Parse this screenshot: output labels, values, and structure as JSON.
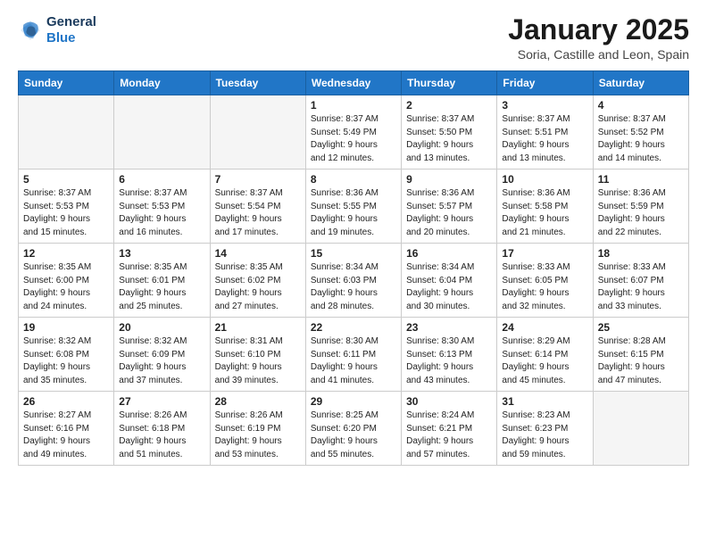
{
  "header": {
    "logo_line1": "General",
    "logo_line2": "Blue",
    "month": "January 2025",
    "location": "Soria, Castille and Leon, Spain"
  },
  "weekdays": [
    "Sunday",
    "Monday",
    "Tuesday",
    "Wednesday",
    "Thursday",
    "Friday",
    "Saturday"
  ],
  "weeks": [
    [
      {
        "day": "",
        "info": ""
      },
      {
        "day": "",
        "info": ""
      },
      {
        "day": "",
        "info": ""
      },
      {
        "day": "1",
        "info": "Sunrise: 8:37 AM\nSunset: 5:49 PM\nDaylight: 9 hours\nand 12 minutes."
      },
      {
        "day": "2",
        "info": "Sunrise: 8:37 AM\nSunset: 5:50 PM\nDaylight: 9 hours\nand 13 minutes."
      },
      {
        "day": "3",
        "info": "Sunrise: 8:37 AM\nSunset: 5:51 PM\nDaylight: 9 hours\nand 13 minutes."
      },
      {
        "day": "4",
        "info": "Sunrise: 8:37 AM\nSunset: 5:52 PM\nDaylight: 9 hours\nand 14 minutes."
      }
    ],
    [
      {
        "day": "5",
        "info": "Sunrise: 8:37 AM\nSunset: 5:53 PM\nDaylight: 9 hours\nand 15 minutes."
      },
      {
        "day": "6",
        "info": "Sunrise: 8:37 AM\nSunset: 5:53 PM\nDaylight: 9 hours\nand 16 minutes."
      },
      {
        "day": "7",
        "info": "Sunrise: 8:37 AM\nSunset: 5:54 PM\nDaylight: 9 hours\nand 17 minutes."
      },
      {
        "day": "8",
        "info": "Sunrise: 8:36 AM\nSunset: 5:55 PM\nDaylight: 9 hours\nand 19 minutes."
      },
      {
        "day": "9",
        "info": "Sunrise: 8:36 AM\nSunset: 5:57 PM\nDaylight: 9 hours\nand 20 minutes."
      },
      {
        "day": "10",
        "info": "Sunrise: 8:36 AM\nSunset: 5:58 PM\nDaylight: 9 hours\nand 21 minutes."
      },
      {
        "day": "11",
        "info": "Sunrise: 8:36 AM\nSunset: 5:59 PM\nDaylight: 9 hours\nand 22 minutes."
      }
    ],
    [
      {
        "day": "12",
        "info": "Sunrise: 8:35 AM\nSunset: 6:00 PM\nDaylight: 9 hours\nand 24 minutes."
      },
      {
        "day": "13",
        "info": "Sunrise: 8:35 AM\nSunset: 6:01 PM\nDaylight: 9 hours\nand 25 minutes."
      },
      {
        "day": "14",
        "info": "Sunrise: 8:35 AM\nSunset: 6:02 PM\nDaylight: 9 hours\nand 27 minutes."
      },
      {
        "day": "15",
        "info": "Sunrise: 8:34 AM\nSunset: 6:03 PM\nDaylight: 9 hours\nand 28 minutes."
      },
      {
        "day": "16",
        "info": "Sunrise: 8:34 AM\nSunset: 6:04 PM\nDaylight: 9 hours\nand 30 minutes."
      },
      {
        "day": "17",
        "info": "Sunrise: 8:33 AM\nSunset: 6:05 PM\nDaylight: 9 hours\nand 32 minutes."
      },
      {
        "day": "18",
        "info": "Sunrise: 8:33 AM\nSunset: 6:07 PM\nDaylight: 9 hours\nand 33 minutes."
      }
    ],
    [
      {
        "day": "19",
        "info": "Sunrise: 8:32 AM\nSunset: 6:08 PM\nDaylight: 9 hours\nand 35 minutes."
      },
      {
        "day": "20",
        "info": "Sunrise: 8:32 AM\nSunset: 6:09 PM\nDaylight: 9 hours\nand 37 minutes."
      },
      {
        "day": "21",
        "info": "Sunrise: 8:31 AM\nSunset: 6:10 PM\nDaylight: 9 hours\nand 39 minutes."
      },
      {
        "day": "22",
        "info": "Sunrise: 8:30 AM\nSunset: 6:11 PM\nDaylight: 9 hours\nand 41 minutes."
      },
      {
        "day": "23",
        "info": "Sunrise: 8:30 AM\nSunset: 6:13 PM\nDaylight: 9 hours\nand 43 minutes."
      },
      {
        "day": "24",
        "info": "Sunrise: 8:29 AM\nSunset: 6:14 PM\nDaylight: 9 hours\nand 45 minutes."
      },
      {
        "day": "25",
        "info": "Sunrise: 8:28 AM\nSunset: 6:15 PM\nDaylight: 9 hours\nand 47 minutes."
      }
    ],
    [
      {
        "day": "26",
        "info": "Sunrise: 8:27 AM\nSunset: 6:16 PM\nDaylight: 9 hours\nand 49 minutes."
      },
      {
        "day": "27",
        "info": "Sunrise: 8:26 AM\nSunset: 6:18 PM\nDaylight: 9 hours\nand 51 minutes."
      },
      {
        "day": "28",
        "info": "Sunrise: 8:26 AM\nSunset: 6:19 PM\nDaylight: 9 hours\nand 53 minutes."
      },
      {
        "day": "29",
        "info": "Sunrise: 8:25 AM\nSunset: 6:20 PM\nDaylight: 9 hours\nand 55 minutes."
      },
      {
        "day": "30",
        "info": "Sunrise: 8:24 AM\nSunset: 6:21 PM\nDaylight: 9 hours\nand 57 minutes."
      },
      {
        "day": "31",
        "info": "Sunrise: 8:23 AM\nSunset: 6:23 PM\nDaylight: 9 hours\nand 59 minutes."
      },
      {
        "day": "",
        "info": ""
      }
    ]
  ]
}
